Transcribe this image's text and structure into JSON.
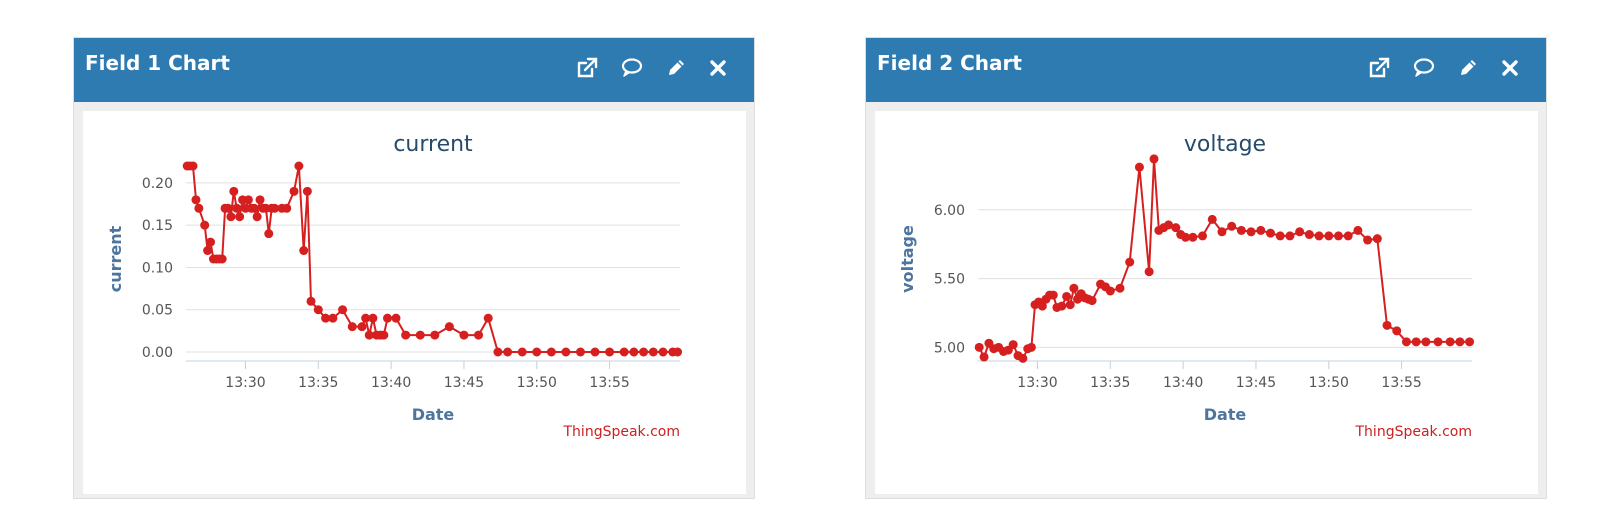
{
  "panels": [
    {
      "title": "Field 1 Chart",
      "icons": [
        "external-link-icon",
        "comment-icon",
        "pencil-icon",
        "close-icon"
      ],
      "credit": "ThingSpeak.com"
    },
    {
      "title": "Field 2 Chart",
      "icons": [
        "external-link-icon",
        "comment-icon",
        "pencil-icon",
        "close-icon"
      ],
      "credit": "ThingSpeak.com"
    }
  ],
  "chart_data": [
    {
      "type": "line",
      "title": "current",
      "xlabel": "Date",
      "ylabel": "current",
      "color": "#d62020",
      "xlim": [
        "13:25:55",
        "13:59:50"
      ],
      "ylim": [
        0,
        0.22
      ],
      "ytick_values": [
        0,
        0.05,
        0.1,
        0.15,
        0.2
      ],
      "yticks": [
        "0.00",
        "0.05",
        "0.10",
        "0.15",
        "0.20"
      ],
      "xtick_values": [
        "13:30",
        "13:35",
        "13:40",
        "13:45",
        "13:50",
        "13:55"
      ],
      "xticks": [
        "13:30",
        "13:35",
        "13:40",
        "13:45",
        "13:50",
        "13:55"
      ],
      "x": [
        "13:26:00",
        "13:26:12",
        "13:26:24",
        "13:26:36",
        "13:26:48",
        "13:27:12",
        "13:27:24",
        "13:27:36",
        "13:27:48",
        "13:28:00",
        "13:28:12",
        "13:28:24",
        "13:28:36",
        "13:28:48",
        "13:29:00",
        "13:29:12",
        "13:29:24",
        "13:29:36",
        "13:29:48",
        "13:30:00",
        "13:30:12",
        "13:30:24",
        "13:30:36",
        "13:30:48",
        "13:31:00",
        "13:31:12",
        "13:31:24",
        "13:31:36",
        "13:31:48",
        "13:32:00",
        "13:32:30",
        "13:32:50",
        "13:33:20",
        "13:33:40",
        "13:34:00",
        "13:34:15",
        "13:34:30",
        "13:35:00",
        "13:35:30",
        "13:36:00",
        "13:36:40",
        "13:37:20",
        "13:38:00",
        "13:38:15",
        "13:38:30",
        "13:38:45",
        "13:39:00",
        "13:39:15",
        "13:39:30",
        "13:39:45",
        "13:40:20",
        "13:41:00",
        "13:42:00",
        "13:43:00",
        "13:44:00",
        "13:45:00",
        "13:46:00",
        "13:46:40",
        "13:47:20",
        "13:48:00",
        "13:49:00",
        "13:50:00",
        "13:51:00",
        "13:52:00",
        "13:53:00",
        "13:54:00",
        "13:55:00",
        "13:56:00",
        "13:56:40",
        "13:57:20",
        "13:58:00",
        "13:58:40",
        "13:59:20",
        "13:59:40"
      ],
      "y": [
        0.22,
        0.22,
        0.22,
        0.18,
        0.17,
        0.15,
        0.12,
        0.13,
        0.11,
        0.11,
        0.11,
        0.11,
        0.17,
        0.17,
        0.16,
        0.19,
        0.17,
        0.16,
        0.18,
        0.17,
        0.18,
        0.17,
        0.17,
        0.16,
        0.18,
        0.17,
        0.17,
        0.14,
        0.17,
        0.17,
        0.17,
        0.17,
        0.19,
        0.22,
        0.12,
        0.19,
        0.06,
        0.05,
        0.04,
        0.04,
        0.05,
        0.03,
        0.03,
        0.04,
        0.02,
        0.04,
        0.02,
        0.02,
        0.02,
        0.04,
        0.04,
        0.02,
        0.02,
        0.02,
        0.03,
        0.02,
        0.02,
        0.04,
        0.0,
        0.0,
        0.0,
        0.0,
        0.0,
        0.0,
        0.0,
        0.0,
        0.0,
        0.0,
        0.0,
        0.0,
        0.0,
        0.0,
        0.0,
        0.0
      ]
    },
    {
      "type": "line",
      "title": "voltage",
      "xlabel": "Date",
      "ylabel": "voltage",
      "color": "#d62020",
      "xlim": [
        "13:25:55",
        "13:59:50"
      ],
      "ylim": [
        4.85,
        6.5
      ],
      "ytick_values": [
        5.0,
        5.5,
        6.0
      ],
      "yticks": [
        "5.00",
        "5.50",
        "6.00"
      ],
      "xtick_values": [
        "13:30",
        "13:35",
        "13:40",
        "13:45",
        "13:50",
        "13:55"
      ],
      "xticks": [
        "13:30",
        "13:35",
        "13:40",
        "13:45",
        "13:50",
        "13:55"
      ],
      "x": [
        "13:26:00",
        "13:26:20",
        "13:26:40",
        "13:27:00",
        "13:27:20",
        "13:27:40",
        "13:28:00",
        "13:28:20",
        "13:28:40",
        "13:29:00",
        "13:29:20",
        "13:29:35",
        "13:29:50",
        "13:30:05",
        "13:30:20",
        "13:30:35",
        "13:30:50",
        "13:31:05",
        "13:31:20",
        "13:31:40",
        "13:32:00",
        "13:32:15",
        "13:32:30",
        "13:32:45",
        "13:33:00",
        "13:33:15",
        "13:33:30",
        "13:33:45",
        "13:34:20",
        "13:34:40",
        "13:35:00",
        "13:35:40",
        "13:36:20",
        "13:37:00",
        "13:37:40",
        "13:38:00",
        "13:38:20",
        "13:38:40",
        "13:39:00",
        "13:39:30",
        "13:39:50",
        "13:40:10",
        "13:40:40",
        "13:41:20",
        "13:42:00",
        "13:42:40",
        "13:43:20",
        "13:44:00",
        "13:44:40",
        "13:45:20",
        "13:46:00",
        "13:46:40",
        "13:47:20",
        "13:48:00",
        "13:48:40",
        "13:49:20",
        "13:50:00",
        "13:50:40",
        "13:51:20",
        "13:52:00",
        "13:52:40",
        "13:53:20",
        "13:54:00",
        "13:54:40",
        "13:55:20",
        "13:56:00",
        "13:56:40",
        "13:57:30",
        "13:58:20",
        "13:59:00",
        "13:59:40"
      ],
      "y": [
        5.0,
        4.93,
        5.03,
        4.99,
        5.0,
        4.97,
        4.98,
        5.02,
        4.94,
        4.92,
        4.99,
        5.0,
        5.31,
        5.33,
        5.3,
        5.35,
        5.38,
        5.38,
        5.29,
        5.3,
        5.37,
        5.31,
        5.43,
        5.35,
        5.39,
        5.36,
        5.35,
        5.34,
        5.46,
        5.44,
        5.41,
        5.43,
        5.62,
        6.31,
        5.55,
        6.37,
        5.85,
        5.87,
        5.89,
        5.87,
        5.82,
        5.8,
        5.8,
        5.81,
        5.93,
        5.84,
        5.88,
        5.85,
        5.84,
        5.85,
        5.83,
        5.81,
        5.81,
        5.84,
        5.82,
        5.81,
        5.81,
        5.81,
        5.81,
        5.85,
        5.78,
        5.79,
        5.16,
        5.12,
        5.04,
        5.04,
        5.04,
        5.04,
        5.04,
        5.04,
        5.04
      ]
    }
  ]
}
